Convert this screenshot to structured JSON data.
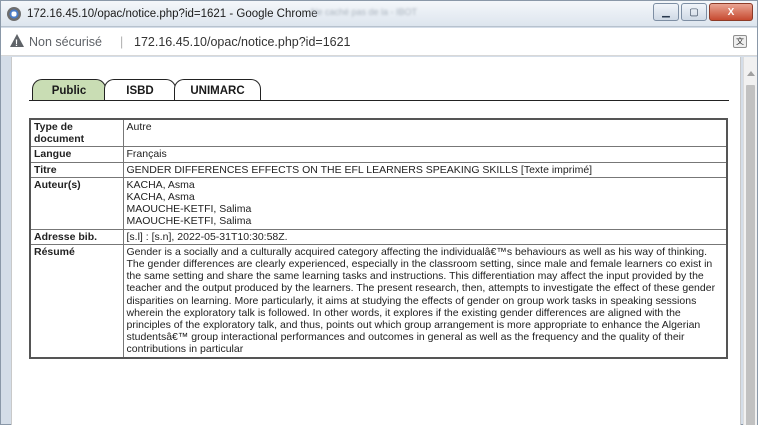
{
  "window": {
    "title": "172.16.45.10/opac/notice.php?id=1621 - Google Chrome",
    "blurred_title_text": "Ne caché pas de la - IBOT",
    "buttons": {
      "minimize": "▁",
      "maximize": "▢",
      "close": "X"
    }
  },
  "address_bar": {
    "security_label": "Non sécurisé",
    "separator": "|",
    "url": "172.16.45.10/opac/notice.php?id=1621"
  },
  "tabs": [
    {
      "label": "Public",
      "active": true
    },
    {
      "label": "ISBD",
      "active": false
    },
    {
      "label": "UNIMARC",
      "active": false
    }
  ],
  "notice": {
    "type_document": {
      "label": "Type de document",
      "value": "Autre"
    },
    "langue": {
      "label": "Langue",
      "value": "Français"
    },
    "titre": {
      "label": "Titre",
      "value": "GENDER DIFFERENCES EFFECTS ON THE EFL LEARNERS SPEAKING SKILLS [Texte imprimé]"
    },
    "auteurs": {
      "label": "Auteur(s)",
      "values": [
        "KACHA, Asma",
        "KACHA, Asma",
        "MAOUCHE-KETFI, Salima",
        "MAOUCHE-KETFI, Salima"
      ]
    },
    "adresse": {
      "label": "Adresse bib.",
      "value": "[s.l] : [s.n], 2022-05-31T10:30:58Z."
    },
    "resume": {
      "label": "Résumé",
      "value": "Gender is a socially and a culturally acquired category affecting the individualâ€™s behaviours as well as his way of thinking. The gender differences are clearly experienced, especially in the classroom setting, since male and female learners co exist in the same setting and share the same learning tasks and instructions. This differentiation may affect the input provided by the teacher and the output produced by the learners. The present research, then, attempts to investigate the effect of these gender disparities on learning. More particularly, it aims at studying the effects of gender on group work tasks in speaking sessions wherein the exploratory talk is followed. In other words, it explores if the existing gender differences are aligned with the principles of the exploratory talk, and thus, points out which group arrangement is more appropriate to enhance the Algerian studentsâ€™ group interactional performances and outcomes in general as well as the frequency and the quality of their contributions in particular"
    }
  },
  "colors": {
    "active_tab": "#c9ddb4",
    "title_bar": "#dde5ee",
    "close_button": "#c74a30"
  }
}
